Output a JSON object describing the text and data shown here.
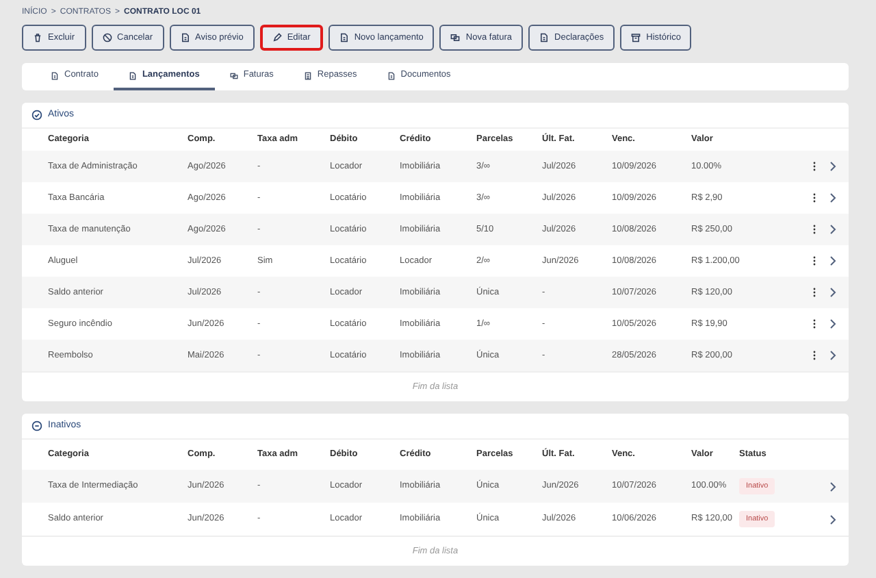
{
  "breadcrumb": [
    {
      "label": "INÍCIO",
      "current": false
    },
    {
      "label": "CONTRATOS",
      "current": false
    },
    {
      "label": "CONTRATO LOC 01",
      "current": true
    }
  ],
  "breadcrumb_separator": ">",
  "actions": [
    {
      "label": "Excluir",
      "highlighted": false
    },
    {
      "label": "Cancelar",
      "highlighted": false
    },
    {
      "label": "Aviso prévio",
      "highlighted": false
    },
    {
      "label": "Editar",
      "highlighted": true
    },
    {
      "label": "Novo lançamento",
      "highlighted": false
    },
    {
      "label": "Nova fatura",
      "highlighted": false
    },
    {
      "label": "Declarações",
      "highlighted": false
    },
    {
      "label": "Histórico",
      "highlighted": false
    }
  ],
  "tabs": [
    {
      "label": "Contrato",
      "selected": false
    },
    {
      "label": "Lançamentos",
      "selected": true
    },
    {
      "label": "Faturas",
      "selected": false
    },
    {
      "label": "Repasses",
      "selected": false
    },
    {
      "label": "Documentos",
      "selected": false
    }
  ],
  "sections": [
    {
      "title": "Ativos",
      "kind": "active",
      "row_menu": true,
      "columns": [
        "Categoria",
        "Comp.",
        "Taxa adm",
        "Débito",
        "Crédito",
        "Parcelas",
        "Últ. Fat.",
        "Venc.",
        "Valor"
      ],
      "rows": [
        {
          "cells": [
            "Taxa de Administração",
            "Ago/2026",
            "-",
            "Locador",
            "Imobiliária",
            "3/∞",
            "Jul/2026",
            "10/09/2026",
            "10.00%"
          ]
        },
        {
          "cells": [
            "Taxa Bancária",
            "Ago/2026",
            "-",
            "Locatário",
            "Imobiliária",
            "3/∞",
            "Jul/2026",
            "10/09/2026",
            "R$ 2,90"
          ]
        },
        {
          "cells": [
            "Taxa de manutenção",
            "Ago/2026",
            "-",
            "Locatário",
            "Imobiliária",
            "5/10",
            "Jul/2026",
            "10/08/2026",
            "R$ 250,00"
          ]
        },
        {
          "cells": [
            "Aluguel",
            "Jul/2026",
            "Sim",
            "Locatário",
            "Locador",
            "2/∞",
            "Jun/2026",
            "10/08/2026",
            "R$ 1.200,00"
          ]
        },
        {
          "cells": [
            "Saldo anterior",
            "Jul/2026",
            "-",
            "Locador",
            "Imobiliária",
            "Única",
            "-",
            "10/07/2026",
            "R$ 120,00"
          ]
        },
        {
          "cells": [
            "Seguro incêndio",
            "Jun/2026",
            "-",
            "Locatário",
            "Imobiliária",
            "1/∞",
            "-",
            "10/05/2026",
            "R$ 19,90"
          ]
        },
        {
          "cells": [
            "Reembolso",
            "Mai/2026",
            "-",
            "Locatário",
            "Imobiliária",
            "Única",
            "-",
            "28/05/2026",
            "R$ 200,00"
          ]
        }
      ],
      "footer": "Fim da lista"
    },
    {
      "title": "Inativos",
      "kind": "inactive",
      "row_menu": false,
      "columns": [
        "Categoria",
        "Comp.",
        "Taxa adm",
        "Débito",
        "Crédito",
        "Parcelas",
        "Últ. Fat.",
        "Venc.",
        "Valor",
        "Status"
      ],
      "rows": [
        {
          "cells": [
            "Taxa de Intermediação",
            "Jun/2026",
            "-",
            "Locador",
            "Imobiliária",
            "Única",
            "Jun/2026",
            "10/07/2026",
            "100.00%"
          ],
          "status": "Inativo"
        },
        {
          "cells": [
            "Saldo anterior",
            "Jun/2026",
            "-",
            "Locador",
            "Imobiliária",
            "Única",
            "Jul/2026",
            "10/06/2026",
            "R$ 120,00"
          ],
          "status": "Inativo"
        }
      ],
      "footer": "Fim da lista"
    }
  ]
}
